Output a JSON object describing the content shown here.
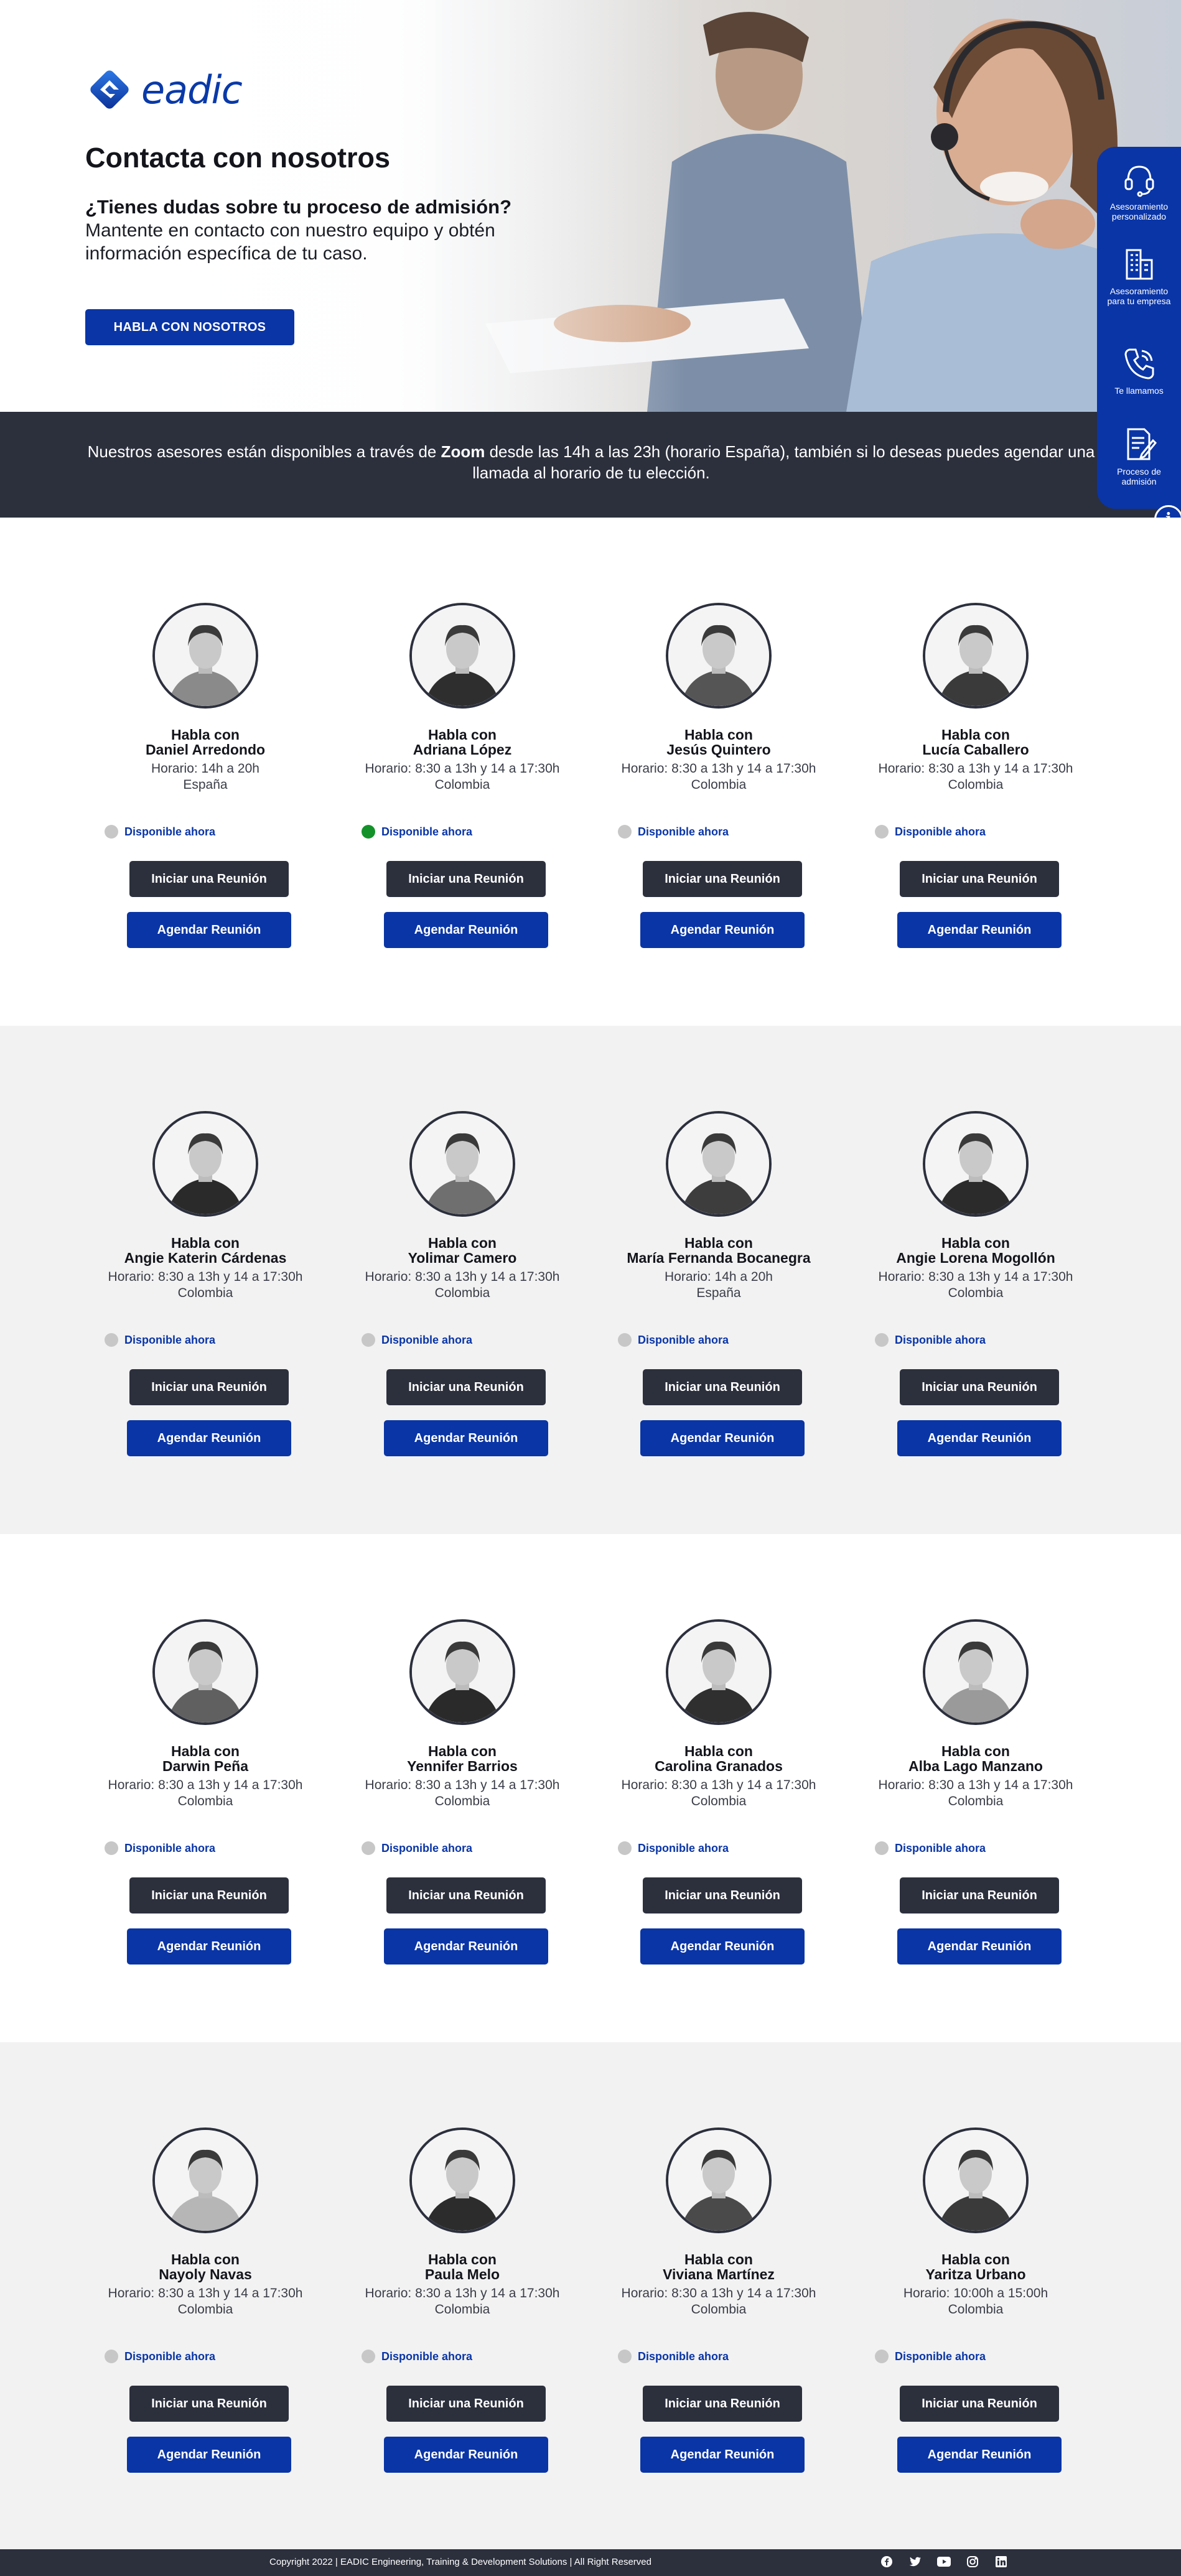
{
  "brand": {
    "name": "eadic"
  },
  "hero": {
    "title": "Contacta con nosotros",
    "question": "¿Tienes dudas sobre tu proceso de admisión?",
    "subtitle": "Mantente en contacto con nuestro equipo y obtén información específica de tu caso.",
    "cta_label": "HABLA CON NOSOTROS"
  },
  "banner": {
    "text_before": "Nuestros asesores están disponibles a través de ",
    "highlight": "Zoom",
    "text_after": " desde las 14h a las 23h (horario España), también si lo deseas puedes agendar una llamada al horario de tu elección."
  },
  "side_panel": {
    "items": [
      {
        "label": "Asesoramiento personalizado",
        "icon": "headset-icon"
      },
      {
        "label": "Asesoramiento para tu empresa",
        "icon": "building-icon"
      },
      {
        "label": "Te llamamos",
        "icon": "phone-icon"
      },
      {
        "label": "Proceso de admisión",
        "icon": "document-icon"
      }
    ],
    "info_label": "i"
  },
  "common": {
    "talk_label": "Habla con",
    "status_label": "Disponible ahora",
    "meeting_label": "Iniciar una Reunión",
    "schedule_label": "Agendar Reunión"
  },
  "colors": {
    "primary": "#0a35a6",
    "dark": "#2c303d",
    "available": "#13922a",
    "unavailable": "#c7c7c7"
  },
  "agents": [
    {
      "name": "Daniel Arredondo",
      "hours": "Horario: 14h a 20h",
      "country": "España",
      "available": false
    },
    {
      "name": "Adriana López",
      "hours": "Horario: 8:30 a 13h y 14 a 17:30h",
      "country": "Colombia",
      "available": true
    },
    {
      "name": "Jesús Quintero",
      "hours": "Horario: 8:30 a 13h y 14 a 17:30h",
      "country": "Colombia",
      "available": false
    },
    {
      "name": "Lucía Caballero",
      "hours": "Horario: 8:30 a 13h y 14 a 17:30h",
      "country": "Colombia",
      "available": false
    },
    {
      "name": "Angie Katerin Cárdenas",
      "hours": "Horario: 8:30 a 13h y 14 a 17:30h",
      "country": "Colombia",
      "available": false
    },
    {
      "name": "Yolimar Camero",
      "hours": "Horario: 8:30 a 13h y 14 a 17:30h",
      "country": "Colombia",
      "available": false
    },
    {
      "name": "María Fernanda Bocanegra",
      "hours": "Horario: 14h a 20h",
      "country": "España",
      "available": false
    },
    {
      "name": "Angie Lorena Mogollón",
      "hours": "Horario: 8:30 a 13h y 14 a 17:30h",
      "country": "Colombia",
      "available": false
    },
    {
      "name": "Darwin Peña",
      "hours": "Horario: 8:30 a 13h y 14 a 17:30h",
      "country": "Colombia",
      "available": false
    },
    {
      "name": "Yennifer Barrios",
      "hours": "Horario: 8:30 a 13h y 14 a 17:30h",
      "country": "Colombia",
      "available": false
    },
    {
      "name": "Carolina Granados",
      "hours": "Horario: 8:30 a 13h y 14 a 17:30h",
      "country": "Colombia",
      "available": false
    },
    {
      "name": "Alba Lago Manzano",
      "hours": "Horario: 8:30 a 13h y 14 a 17:30h",
      "country": "Colombia",
      "available": false
    },
    {
      "name": "Nayoly Navas",
      "hours": "Horario: 8:30 a 13h y 14 a 17:30h",
      "country": "Colombia",
      "available": false
    },
    {
      "name": "Paula Melo",
      "hours": "Horario: 8:30 a 13h y 14 a 17:30h",
      "country": "Colombia",
      "available": false
    },
    {
      "name": "Viviana Martínez",
      "hours": "Horario: 8:30 a 13h y 14 a 17:30h",
      "country": "Colombia",
      "available": false
    },
    {
      "name": "Yaritza Urbano",
      "hours": "Horario: 10:00h a 15:00h",
      "country": "Colombia",
      "available": false
    }
  ],
  "footer": {
    "copyright": "Copyright 2022 | EADIC Engineering, Training & Development Solutions | All Right Reserved",
    "socials": [
      "facebook-icon",
      "twitter-icon",
      "youtube-icon",
      "instagram-icon",
      "linkedin-icon"
    ]
  }
}
